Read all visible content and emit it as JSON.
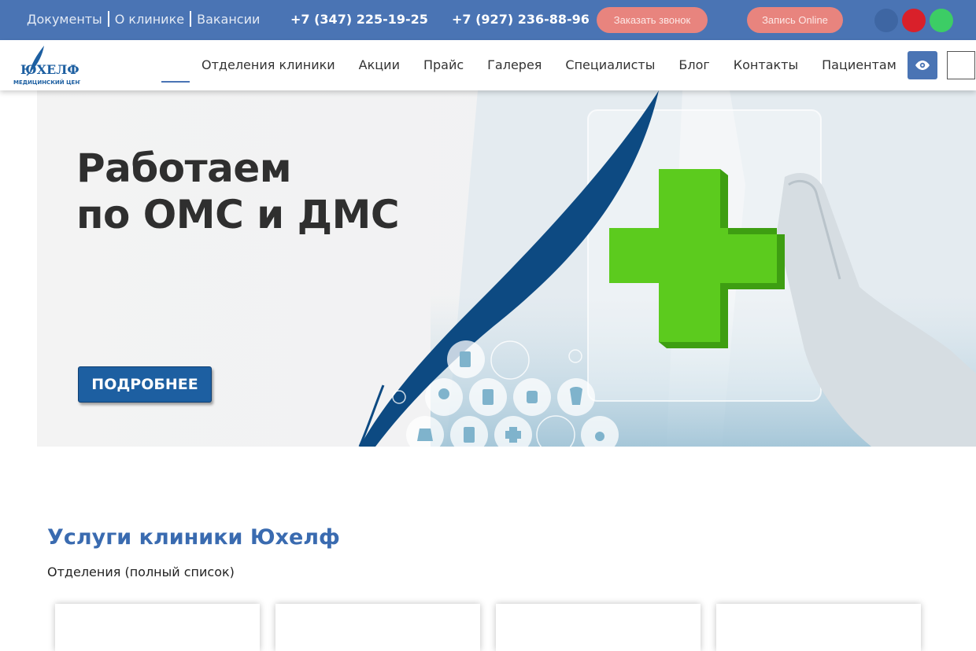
{
  "topbar": {
    "links": [
      "Документы",
      "О клинике",
      "Вакансии"
    ],
    "phones": [
      "+7 (347) 225-19-25",
      "+7 (927) 236-88-96"
    ],
    "buttons": {
      "callback": "Заказать звонок",
      "online": "Запись Online"
    },
    "colors": {
      "background": "#4a74b4",
      "pill": "#e8847e"
    },
    "social_icons": [
      "vk-icon",
      "youtube-icon",
      "whatsapp-icon"
    ]
  },
  "logo": {
    "name": "ЮХЕЛФ",
    "tagline": "МЕДИЦИНСКИЙ ЦЕНТР"
  },
  "nav": {
    "items": [
      "Отделения клиники",
      "Акции",
      "Прайс",
      "Галерея",
      "Специалисты",
      "Блог",
      "Контакты",
      "Пациентам"
    ],
    "accessibility_icon": "eye-icon"
  },
  "banner": {
    "title_line1": "Работаем",
    "title_line2": "по ОМС и ДМС",
    "button": "ПОДРОБНЕЕ"
  },
  "services": {
    "title": "Услуги клиники Юхелф",
    "subtitle": "Отделения (полный список)"
  }
}
